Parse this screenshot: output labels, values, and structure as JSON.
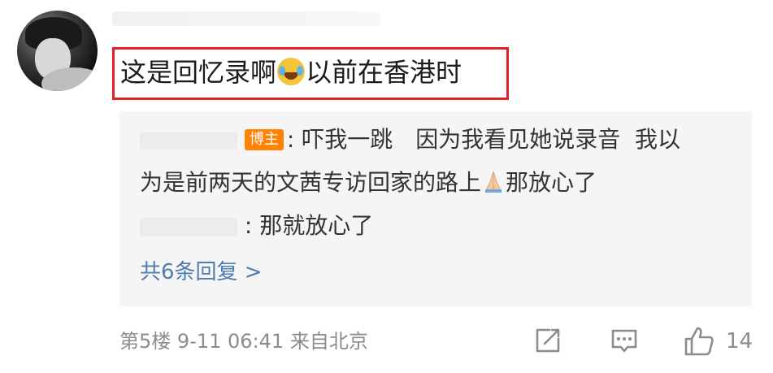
{
  "comment": {
    "text_before_emoji": "这是回忆录啊",
    "text_after_emoji": "以前在香港时"
  },
  "replies": {
    "line1": {
      "badge": "博主",
      "text": ": 吓我一跳　因为我看见她说录音  我以"
    },
    "line2": {
      "text_before_emoji": "为是前两天的文茜专访回家的路上",
      "text_after_emoji": "那放心了"
    },
    "line3": {
      "text": ": 那就放心了"
    },
    "more": "共6条回复 >"
  },
  "meta": {
    "floor": "第5楼",
    "date": "9-11",
    "time": "06:41",
    "location": "来自北京"
  },
  "actions": {
    "like_count": "14"
  },
  "icons": [
    "share-icon",
    "comment-icon",
    "thumbs-up-icon",
    "laughing-tears-emoji",
    "praying-hands-emoji"
  ],
  "colors": {
    "highlight_border": "#e0212a",
    "badge_bg": "#ff8200",
    "link_blue": "#507daf",
    "reply_bg": "#f5f5f5",
    "meta_gray": "#8c8c8c"
  }
}
